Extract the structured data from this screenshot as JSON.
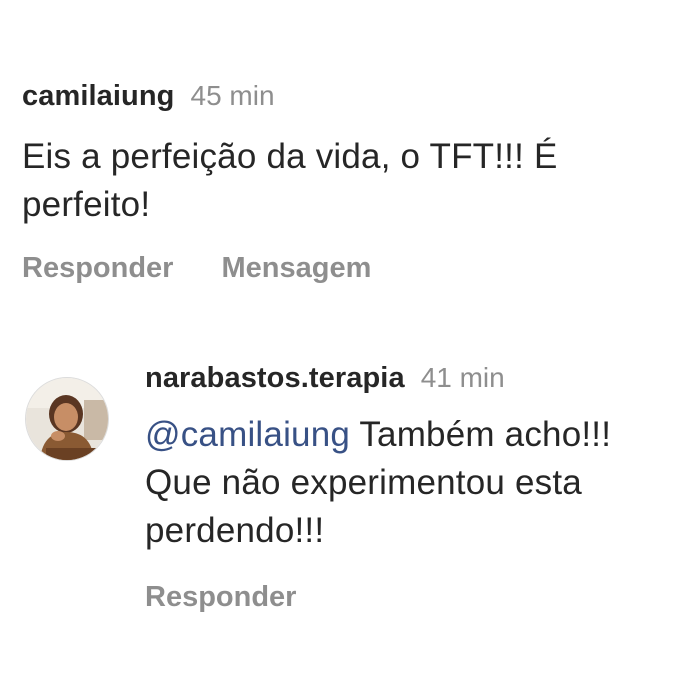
{
  "comments": [
    {
      "username": "camilaiung",
      "time": "45 min",
      "text": "Eis a perfeição da vida, o TFT!!! É perfeito!",
      "actions": [
        "Responder",
        "Mensagem"
      ]
    },
    {
      "username": "narabastos.terapia",
      "time": "41 min",
      "mention": "@camilaiung",
      "text": " Também acho!!! Que não experimentou esta perdendo!!!",
      "actions": [
        "Responder"
      ],
      "avatar_icon": "user-photo-avatar"
    }
  ],
  "colors": {
    "text": "#262626",
    "secondary": "#8e8e8e",
    "mention": "#385185",
    "background": "#ffffff"
  }
}
